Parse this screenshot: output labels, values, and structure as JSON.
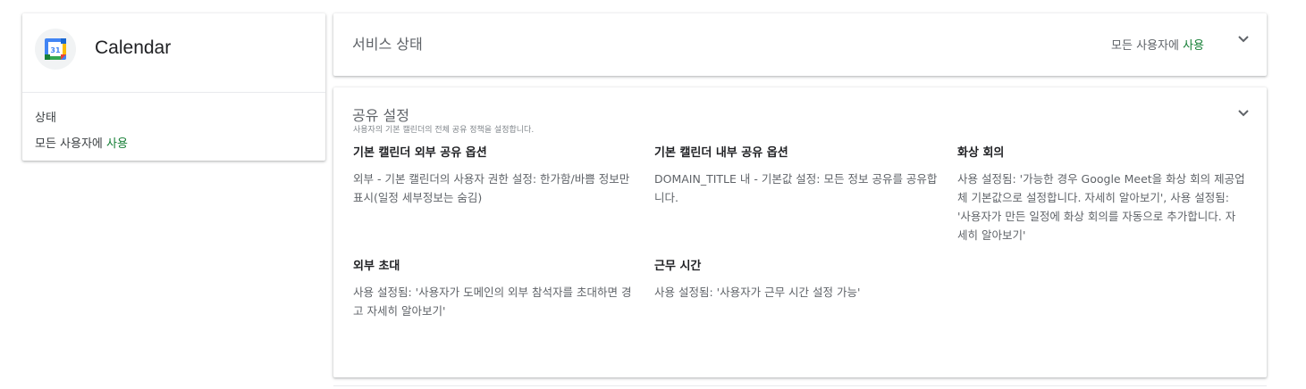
{
  "app_card": {
    "title": "Calendar",
    "logo_text": "31",
    "status_label": "상태",
    "status_prefix": "모든 사용자에",
    "status_value": "사용"
  },
  "service_status": {
    "title": "서비스 상태",
    "value_prefix": "모든 사용자에",
    "value": "사용"
  },
  "sharing": {
    "title": "공유 설정",
    "subtitle": "사용자의 기본 캘린더의 전체 공유 정책을 설정합니다.",
    "items": [
      {
        "title": "기본 캘린더 외부 공유 옵션",
        "description": "외부 - 기본 캘린더의 사용자 권한 설정: 한가함/바쁨 정보만 표시(일정 세부정보는 숨김)"
      },
      {
        "title": "기본 캘린더 내부 공유 옵션",
        "description": "DOMAIN_TITLE 내 - 기본값 설정: 모든 정보 공유를 공유합니다."
      },
      {
        "title": "화상 회의",
        "description": "사용 설정됨: '가능한 경우 Google Meet을 화상 회의 제공업체 기본값으로 설정합니다. 자세히 알아보기', 사용 설정됨: '사용자가 만든 일정에 화상 회의를 자동으로 추가합니다. 자세히 알아보기'"
      },
      {
        "title": "외부 초대",
        "description": "사용 설정됨: '사용자가 도메인의 외부 참석자를 초대하면 경고 자세히 알아보기'"
      },
      {
        "title": "근무 시간",
        "description": "사용 설정됨: '사용자가 근무 시간 설정 가능'"
      }
    ]
  },
  "icons": {
    "app_logo": "google-calendar-logo",
    "expand": "chevron-down-icon"
  },
  "colors": {
    "enabled_green": "#188038",
    "secondary_text": "#5f6368",
    "calendar_blue": "#4285f4"
  }
}
